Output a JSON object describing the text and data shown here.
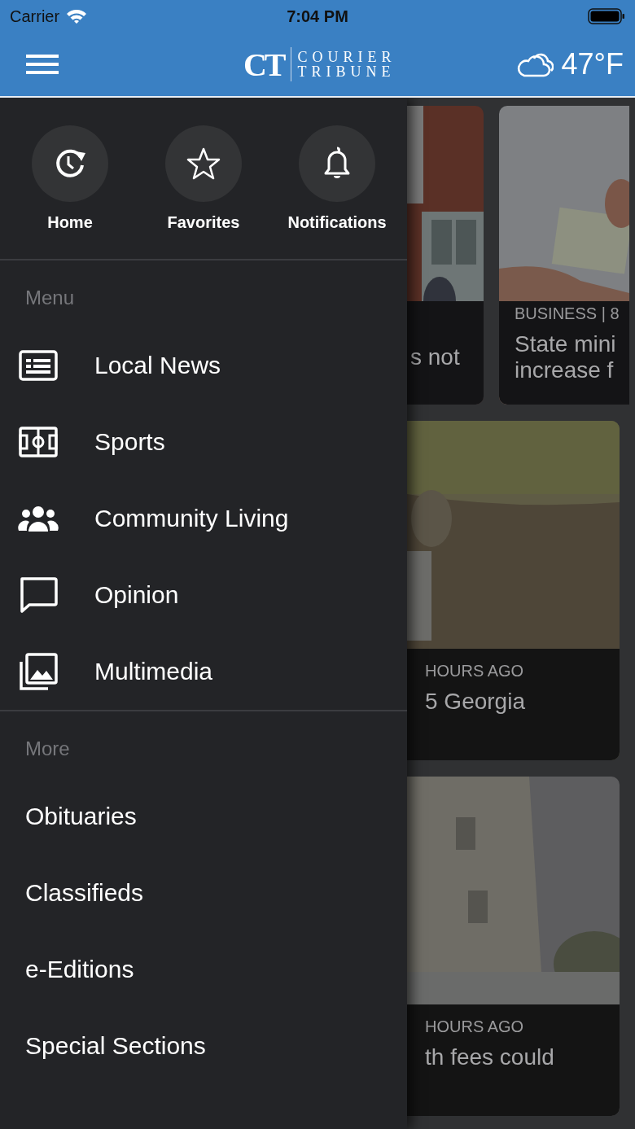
{
  "status_bar": {
    "carrier": "Carrier",
    "time": "7:04 PM"
  },
  "header": {
    "logo": {
      "mark": "CT",
      "line1": "COURIER",
      "line2": "TRIBUNE"
    },
    "weather": "47°F"
  },
  "drawer": {
    "quick_links": [
      {
        "label": "Home",
        "kind": "home"
      },
      {
        "label": "Favorites",
        "kind": "favorites"
      },
      {
        "label": "Notifications",
        "kind": "notifications"
      }
    ],
    "sections": [
      {
        "title": "Menu",
        "items": [
          {
            "label": "Local News",
            "kind": "news"
          },
          {
            "label": "Sports",
            "kind": "sports"
          },
          {
            "label": "Community Living",
            "kind": "community"
          },
          {
            "label": "Opinion",
            "kind": "opinion"
          },
          {
            "label": "Multimedia",
            "kind": "multimedia"
          }
        ]
      },
      {
        "title": "More",
        "items": [
          {
            "label": "Obituaries",
            "kind": "plain"
          },
          {
            "label": "Classifieds",
            "kind": "plain"
          },
          {
            "label": "e-Editions",
            "kind": "plain"
          },
          {
            "label": "Special Sections",
            "kind": "plain"
          }
        ]
      }
    ]
  },
  "feed": {
    "cards": [
      {
        "title_lines": [
          "s not"
        ]
      },
      {
        "category": "BUSINESS | 8",
        "title_lines": [
          "State mini",
          "increase f"
        ]
      },
      {
        "category": "HOURS AGO",
        "title_lines": [
          "5 Georgia"
        ]
      },
      {
        "category": "HOURS AGO",
        "title_lines": [
          "th fees could"
        ]
      }
    ]
  }
}
